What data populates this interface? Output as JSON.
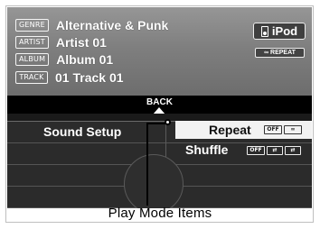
{
  "now_playing": {
    "genre_tag": "GENRE",
    "genre": "Alternative & Punk",
    "artist_tag": "ARTIST",
    "artist": "Artist 01",
    "album_tag": "ALBUM",
    "album": "Album 01",
    "track_tag": "TRACK",
    "track": "01 Track 01"
  },
  "source": {
    "label": "iPod",
    "icon": "ipod-icon"
  },
  "repeat_status": "REPEAT",
  "back_label": "BACK",
  "menu": {
    "sound_setup": "Sound Setup",
    "repeat": "Repeat",
    "shuffle": "Shuffle",
    "off_label": "OFF"
  },
  "caption": "Play Mode Items",
  "colors": {
    "screen_bg": "#050505",
    "info_bg": "#7f7f7f",
    "highlight": "#f2f2f2"
  }
}
